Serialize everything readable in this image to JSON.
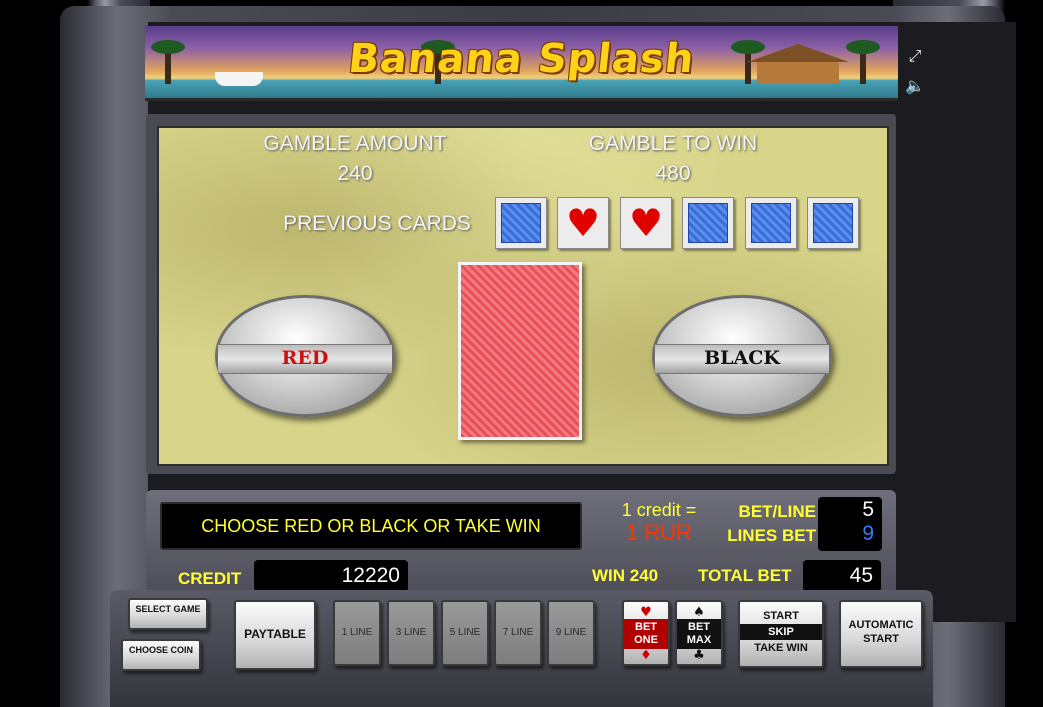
{
  "header": {
    "title": "Banana Splash",
    "fullscreen_icon": "fullscreen-icon",
    "sound_icon": "sound-icon"
  },
  "gamble": {
    "amount_label": "GAMBLE AMOUNT",
    "amount_value": "240",
    "to_win_label": "GAMBLE TO WIN",
    "to_win_value": "480",
    "previous_label": "PREVIOUS CARDS",
    "previous_cards": [
      "back",
      "heart",
      "heart",
      "back",
      "back",
      "back"
    ],
    "red_label": "RED",
    "black_label": "BLACK",
    "heart_symbol": "♥"
  },
  "info": {
    "message": "CHOOSE RED OR BLACK OR TAKE WIN",
    "credit_rate_label": "1 credit =",
    "credit_rate_value": "1 RUR",
    "bet_line_label": "BET/LINE",
    "bet_line_value": "5",
    "lines_bet_label": "LINES BET",
    "lines_bet_value": "9",
    "credit_label": "CREDIT",
    "credit_value": "12220",
    "win_label": "WIN 240",
    "total_bet_label": "TOTAL BET",
    "total_bet_value": "45"
  },
  "buttons": {
    "select_game": "SELECT GAME",
    "choose_coin": "CHOOSE COIN",
    "paytable": "PAYTABLE",
    "lines": [
      "1 LINE",
      "3 LINE",
      "5 LINE",
      "7 LINE",
      "9 LINE"
    ],
    "bet_one": "BET ONE",
    "bet_max": "BET MAX",
    "start": "START",
    "skip": "SKIP",
    "take_win": "TAKE WIN",
    "automatic_start": "AUTOMATIC START",
    "bet_one_top_suit": "♥",
    "bet_one_bottom_suit": "♦",
    "bet_max_top_suit": "♠",
    "bet_max_bottom_suit": "♣"
  },
  "colors": {
    "message_text": "#ffff33",
    "label_yellow": "#ffff33",
    "value_red": "#ff3300",
    "value_blue": "#3a78ff",
    "red_button_text": "#cc1111"
  }
}
